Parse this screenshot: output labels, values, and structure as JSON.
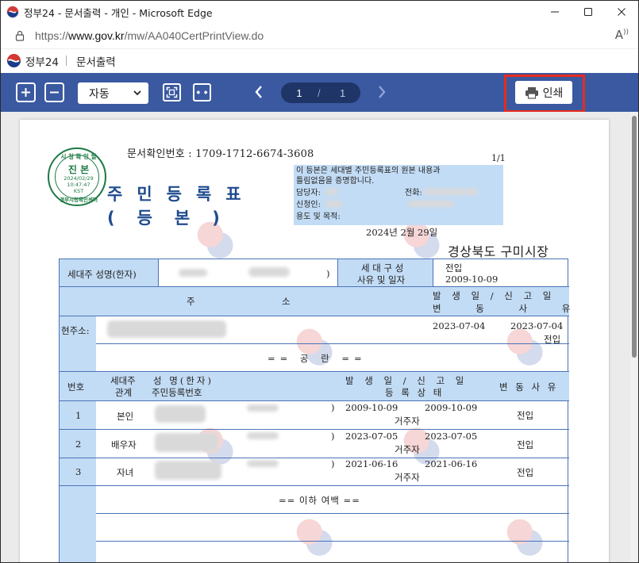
{
  "window": {
    "title": "정부24 - 문서출력 - 개인 - Microsoft Edge",
    "controls": [
      "minimize",
      "maximize",
      "close"
    ]
  },
  "address": {
    "prefix": "https://",
    "host": "www.gov.kr",
    "path": "/mw/AA040CertPrintView.do",
    "read_aloud": "A)"
  },
  "site": {
    "name": "정부24",
    "page": "문서출력"
  },
  "toolbar": {
    "zoom_value": "자동",
    "page_current": "1",
    "page_separator": "/",
    "page_total": "1",
    "print_label": "인쇄"
  },
  "doc": {
    "doc_no": "문서확인번호 : 1709-1712-6674-3608",
    "page_of": "1/1",
    "seal": {
      "top": "시 청 확 인 필",
      "mid": "진 본",
      "date": "2024/02/29",
      "time": "10:47:47",
      "tz": "KST",
      "bottom": "경부시청확인센터"
    },
    "title_line1": "주민등록표",
    "title_line2": "(등본)",
    "cert_lines": [
      "이 등본은 세대별 주민등록표의 원본 내용과",
      "틀림없음을 증명합니다.",
      "담당자:",
      "신청인:",
      "용도 및 목적:"
    ],
    "cert_phone": "전화:",
    "issue_date": "2024년 2월 29일",
    "office": "경상북도 구미시장",
    "head_label": "세대주 성명(한자)",
    "head_paren": ")",
    "reason_label_1": "세 대 구 성",
    "reason_label_2": "사유 및 일자",
    "reason_value_1": "전입",
    "reason_value_2": "2009-10-09",
    "addr_col_1": "주",
    "addr_col_2": "소",
    "date_header_1": "발 생 일 / 신 고 일",
    "date_header_2": "변 동 사 유",
    "current_addr": "현주소:",
    "addr_occur": "2023-07-04",
    "addr_report": "2023-07-04",
    "addr_reason": "전입",
    "vacant": "== 공 란 ==",
    "members_header": {
      "no": "번호",
      "rel_1": "세대주",
      "rel_2": "관계",
      "name_1": "성 명(한자)",
      "name_2": "주민등록번호",
      "dates_1": "발 생 일 / 신 고 일",
      "dates_2": "등 록 상 태",
      "reason": "변 동 사 유"
    },
    "members": [
      {
        "no": "1",
        "rel": "본인",
        "paren": ")",
        "occur": "2009-10-09",
        "report": "2009-10-09",
        "status": "거주자",
        "reason": "전입"
      },
      {
        "no": "2",
        "rel": "배우자",
        "paren": ")",
        "occur": "2023-07-05",
        "report": "2023-07-05",
        "status": "거주자",
        "reason": "전입"
      },
      {
        "no": "3",
        "rel": "자녀",
        "paren": ")",
        "occur": "2021-06-16",
        "report": "2021-06-16",
        "status": "거주자",
        "reason": "전입"
      }
    ],
    "end_note": "== 이하 여백 =="
  },
  "colors": {
    "toolbar": "#3a59a1",
    "page_pill": "#1f3567",
    "highlight": "#ea2a1c",
    "table_header": "#c3dcf5",
    "seal": "#1e7a45",
    "title": "#1f4b8f"
  }
}
